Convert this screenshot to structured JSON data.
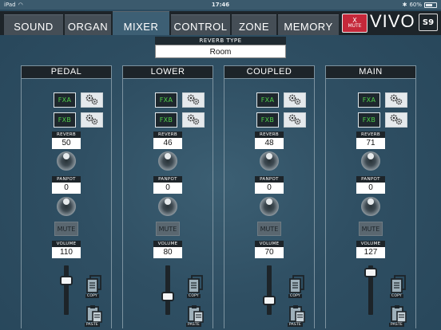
{
  "statusbar": {
    "device": "iPad",
    "time": "17:46",
    "battery": "60%"
  },
  "tabs": [
    {
      "label": "SOUND",
      "active": false
    },
    {
      "label": "ORGAN",
      "active": false
    },
    {
      "label": "MIXER",
      "active": true
    },
    {
      "label": "CONTROL",
      "active": false
    },
    {
      "label": "ZONE",
      "active": false
    },
    {
      "label": "MEMORY",
      "active": false
    }
  ],
  "mute_badge": {
    "x": "X",
    "label": "MUTE"
  },
  "brand": "VIVO",
  "model": "S9",
  "reverb_type": {
    "label": "REVERB TYPE",
    "value": "Room"
  },
  "channel_labels": {
    "fxa": "FXA",
    "fxb": "FXB",
    "reverb": "REVERB",
    "panpot": "PANPOT",
    "mute": "MUTE",
    "volume": "VOLUME",
    "copy": "COPY",
    "paste": "PASTE"
  },
  "channels": [
    {
      "name": "PEDAL",
      "reverb": "50",
      "panpot": "0",
      "volume": "110",
      "fader_level": 0.75
    },
    {
      "name": "LOWER",
      "reverb": "46",
      "panpot": "0",
      "volume": "80",
      "fader_level": 0.35
    },
    {
      "name": "COUPLED",
      "reverb": "48",
      "panpot": "0",
      "volume": "70",
      "fader_level": 0.25
    },
    {
      "name": "MAIN",
      "reverb": "71",
      "panpot": "0",
      "volume": "127",
      "fader_level": 0.95
    }
  ],
  "colors": {
    "fx_text": "#4fd24a",
    "mute_badge": "#c5283a",
    "background": "#2f4f63"
  }
}
